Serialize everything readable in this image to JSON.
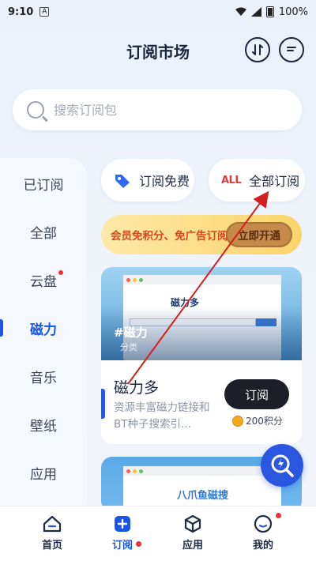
{
  "status": {
    "time": "9:10",
    "notif_letter": "A",
    "battery": "100%"
  },
  "header": {
    "title": "订阅市场",
    "sort_icon": "sort-arrows-icon",
    "msg_icon": "message-icon"
  },
  "search": {
    "placeholder": "搜索订阅包"
  },
  "sidebar": {
    "items": [
      {
        "label": "已订阅"
      },
      {
        "label": "全部"
      },
      {
        "label": "云盘"
      },
      {
        "label": "磁力"
      },
      {
        "label": "音乐"
      },
      {
        "label": "壁纸"
      },
      {
        "label": "应用"
      }
    ]
  },
  "chips": {
    "free": "订阅免费",
    "all_badge": "ALL",
    "all": "全部订阅"
  },
  "promo": {
    "text": "会员免积分、免广告订阅",
    "button": "立即开通"
  },
  "card1": {
    "preview_logo": "磁力多",
    "tag": "#磁力",
    "category": "分类",
    "name": "磁力多",
    "desc": "资源丰富磁力链接和BT种子搜索引...",
    "button": "订阅",
    "points": "200积分"
  },
  "card2": {
    "preview_logo": "八爪鱼磁搜"
  },
  "nav": {
    "home": "首页",
    "subscribe": "订阅",
    "apps": "应用",
    "mine": "我的"
  },
  "colors": {
    "accent": "#1a55e8",
    "badge": "#f0303c",
    "promo": "#fbd46a",
    "annotation": "#d21f1f"
  }
}
